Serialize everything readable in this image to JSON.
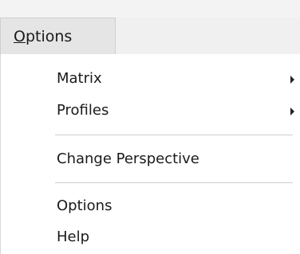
{
  "menubar": {
    "options_menu": {
      "mnemonic": "O",
      "rest": "ptions"
    }
  },
  "dropdown": {
    "items": [
      {
        "label": "Matrix",
        "has_submenu": true
      },
      {
        "label": "Profiles",
        "has_submenu": true
      },
      {
        "label": "Change Perspective",
        "has_submenu": false
      },
      {
        "label": "Options",
        "has_submenu": false
      },
      {
        "label": "Help",
        "has_submenu": false
      }
    ]
  }
}
